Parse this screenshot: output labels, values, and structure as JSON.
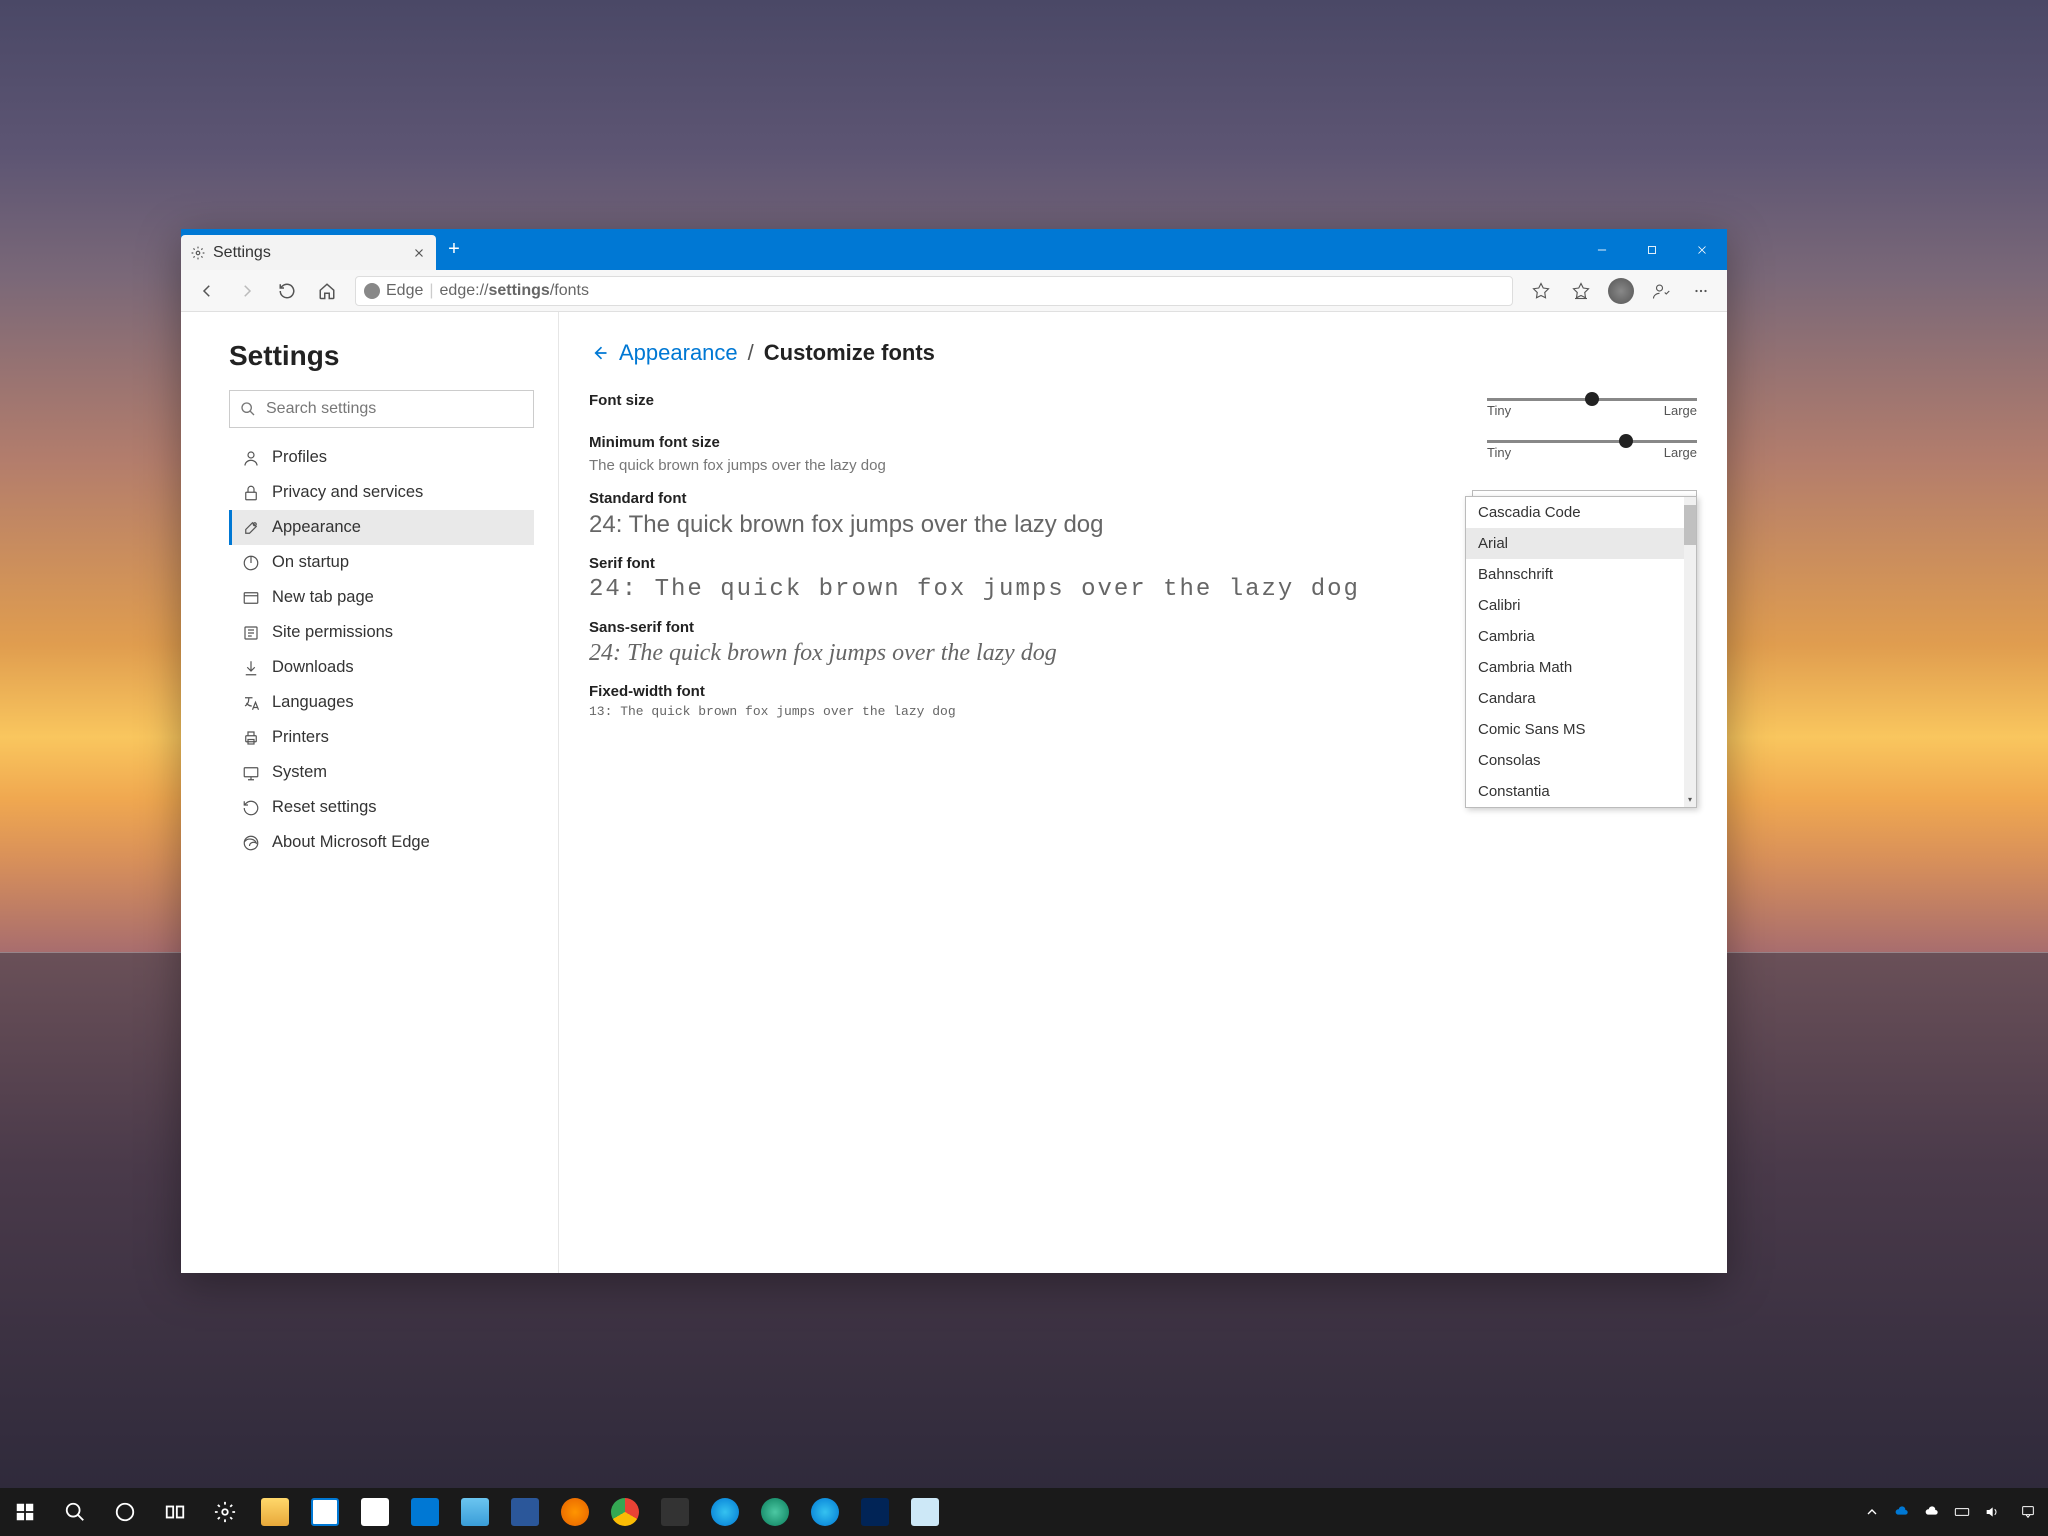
{
  "tab": {
    "title": "Settings"
  },
  "address": {
    "scheme": "Edge",
    "path_prefix": "edge://",
    "path_bold": "settings",
    "path_suffix": "/fonts"
  },
  "sidebar": {
    "title": "Settings",
    "search_placeholder": "Search settings",
    "items": [
      {
        "label": "Profiles",
        "icon": "person"
      },
      {
        "label": "Privacy and services",
        "icon": "lock"
      },
      {
        "label": "Appearance",
        "icon": "brush"
      },
      {
        "label": "On startup",
        "icon": "power"
      },
      {
        "label": "New tab page",
        "icon": "newtab"
      },
      {
        "label": "Site permissions",
        "icon": "permissions"
      },
      {
        "label": "Downloads",
        "icon": "download"
      },
      {
        "label": "Languages",
        "icon": "language"
      },
      {
        "label": "Printers",
        "icon": "printer"
      },
      {
        "label": "System",
        "icon": "system"
      },
      {
        "label": "Reset settings",
        "icon": "reset"
      },
      {
        "label": "About Microsoft Edge",
        "icon": "edge"
      }
    ],
    "active_index": 2
  },
  "breadcrumb": {
    "parent": "Appearance",
    "current": "Customize fonts"
  },
  "fonts": {
    "size_label": "Font size",
    "min_size_label": "Minimum font size",
    "min_size_sample": "The quick brown fox jumps over the lazy dog",
    "standard_label": "Standard font",
    "standard_sample": "24: The quick brown fox jumps over the lazy dog",
    "serif_label": "Serif font",
    "serif_sample": "24: The quick brown fox jumps over the lazy dog",
    "sans_label": "Sans-serif font",
    "sans_sample": "24: The quick brown fox jumps over the lazy dog",
    "fixed_label": "Fixed-width font",
    "fixed_sample": "13: The quick brown fox jumps over the lazy dog",
    "slider_min": "Tiny",
    "slider_max": "Large",
    "size_slider_pos": 50,
    "min_slider_pos": 66,
    "standard_selected": "Arial"
  },
  "dropdown_options": [
    "Cascadia Code",
    "Arial",
    "Bahnschrift",
    "Calibri",
    "Cambria",
    "Cambria Math",
    "Candara",
    "Comic Sans MS",
    "Consolas",
    "Constantia"
  ],
  "dropdown_selected_index": 1
}
